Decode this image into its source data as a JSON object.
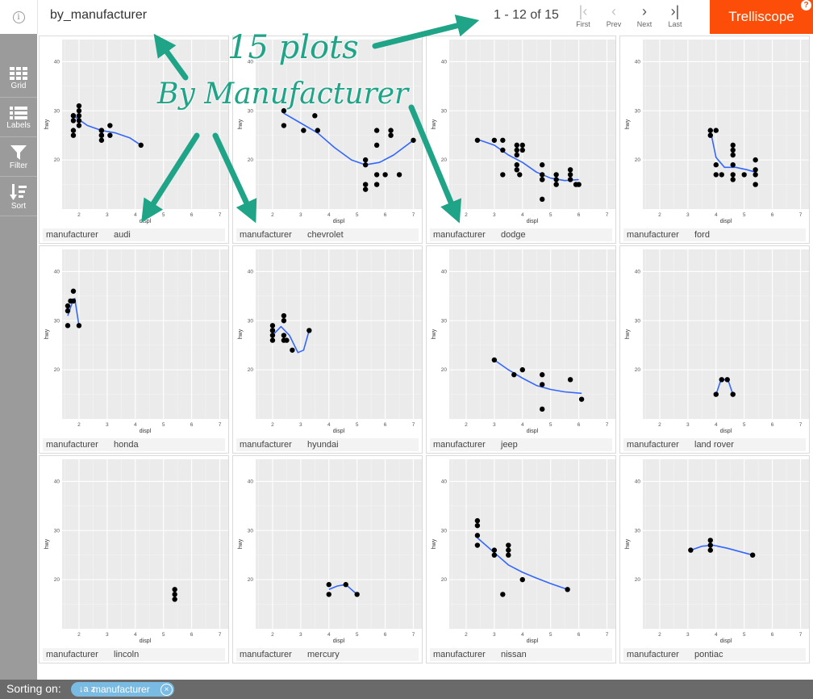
{
  "header": {
    "display_name": "by_manufacturer",
    "pager_text": "1 - 12 of 15",
    "nav": {
      "first": "First",
      "prev": "Prev",
      "next": "Next",
      "last": "Last"
    },
    "brand": "Trelliscope",
    "help": "?"
  },
  "sidebar": {
    "items": [
      {
        "label": "Grid",
        "icon": "grid-icon"
      },
      {
        "label": "Labels",
        "icon": "list-icon"
      },
      {
        "label": "Filter",
        "icon": "funnel-icon"
      },
      {
        "label": "Sort",
        "icon": "sort-icon"
      }
    ]
  },
  "strip_key": "manufacturer",
  "axes": {
    "xlabel": "displ",
    "ylabel": "hwy",
    "xticks": [
      "2",
      "3",
      "4",
      "5",
      "6",
      "7"
    ],
    "yticks": [
      "20",
      "30",
      "40"
    ],
    "xlim": [
      1.4,
      7.3
    ],
    "ylim": [
      10,
      44.5
    ]
  },
  "panels": [
    {
      "manufacturer": "audi",
      "points": [
        [
          1.8,
          29
        ],
        [
          1.8,
          29
        ],
        [
          2,
          31
        ],
        [
          2,
          30
        ],
        [
          2.8,
          26
        ],
        [
          2.8,
          26
        ],
        [
          3.1,
          27
        ],
        [
          1.8,
          26
        ],
        [
          1.8,
          25
        ],
        [
          2,
          28
        ],
        [
          2,
          27
        ],
        [
          2.8,
          25
        ],
        [
          2.8,
          25
        ],
        [
          3.1,
          25
        ],
        [
          4.2,
          23
        ],
        [
          1.8,
          28
        ],
        [
          2,
          29
        ],
        [
          2.8,
          24
        ]
      ],
      "smooth": [
        [
          1.8,
          29
        ],
        [
          2.3,
          27
        ],
        [
          2.8,
          26
        ],
        [
          3.3,
          25.5
        ],
        [
          3.8,
          24.5
        ],
        [
          4.2,
          23
        ]
      ]
    },
    {
      "manufacturer": "chevrolet",
      "points": [
        [
          2.4,
          30
        ],
        [
          2.4,
          27
        ],
        [
          3.1,
          26
        ],
        [
          3.5,
          29
        ],
        [
          3.6,
          26
        ],
        [
          5.3,
          20
        ],
        [
          5.3,
          19
        ],
        [
          5.3,
          15
        ],
        [
          5.3,
          14
        ],
        [
          5.7,
          17
        ],
        [
          6,
          17
        ],
        [
          5.7,
          26
        ],
        [
          5.7,
          23
        ],
        [
          6.2,
          26
        ],
        [
          6.2,
          25
        ],
        [
          7,
          24
        ],
        [
          5.7,
          15
        ],
        [
          6.5,
          17
        ]
      ],
      "smooth": [
        [
          2.4,
          29.5
        ],
        [
          3,
          27.5
        ],
        [
          3.6,
          25.5
        ],
        [
          4.2,
          22.5
        ],
        [
          4.8,
          20
        ],
        [
          5.3,
          19
        ],
        [
          5.8,
          19.5
        ],
        [
          6.3,
          21
        ],
        [
          7,
          24
        ]
      ]
    },
    {
      "manufacturer": "dodge",
      "points": [
        [
          2.4,
          24
        ],
        [
          3,
          24
        ],
        [
          3.3,
          22
        ],
        [
          3.3,
          24
        ],
        [
          3.3,
          17
        ],
        [
          3.8,
          22
        ],
        [
          3.8,
          21
        ],
        [
          3.8,
          18
        ],
        [
          3.8,
          19
        ],
        [
          4,
          23
        ],
        [
          3.9,
          17
        ],
        [
          4.7,
          17
        ],
        [
          4.7,
          16
        ],
        [
          4.7,
          12
        ],
        [
          4.7,
          19
        ],
        [
          5.2,
          17
        ],
        [
          5.2,
          15
        ],
        [
          5.7,
          16
        ],
        [
          5.9,
          15
        ],
        [
          4.7,
          16
        ],
        [
          5.2,
          16
        ],
        [
          5.7,
          18
        ],
        [
          5.7,
          17
        ],
        [
          6,
          15
        ],
        [
          3.8,
          23
        ],
        [
          4,
          22
        ]
      ],
      "smooth": [
        [
          2.4,
          24.2
        ],
        [
          3,
          23
        ],
        [
          3.5,
          21
        ],
        [
          4,
          19.5
        ],
        [
          4.5,
          17.5
        ],
        [
          5,
          16.3
        ],
        [
          5.5,
          15.8
        ],
        [
          6,
          16
        ]
      ]
    },
    {
      "manufacturer": "ford",
      "points": [
        [
          3.8,
          25
        ],
        [
          3.8,
          26
        ],
        [
          4,
          26
        ],
        [
          4,
          19
        ],
        [
          4,
          17
        ],
        [
          4.2,
          17
        ],
        [
          4.6,
          23
        ],
        [
          4.6,
          22
        ],
        [
          4.6,
          21
        ],
        [
          4.6,
          19
        ],
        [
          4.6,
          17
        ],
        [
          4.6,
          16
        ],
        [
          5,
          17
        ],
        [
          5.4,
          20
        ],
        [
          5.4,
          18
        ],
        [
          5.4,
          17
        ],
        [
          5.4,
          15
        ]
      ],
      "smooth": [
        [
          3.8,
          26
        ],
        [
          4,
          20.5
        ],
        [
          4.3,
          18.5
        ],
        [
          4.7,
          18.5
        ],
        [
          5.1,
          18
        ],
        [
          5.4,
          17.5
        ]
      ]
    },
    {
      "manufacturer": "honda",
      "points": [
        [
          1.6,
          33
        ],
        [
          1.6,
          32
        ],
        [
          1.6,
          29
        ],
        [
          1.8,
          36
        ],
        [
          1.8,
          34
        ],
        [
          2,
          29
        ],
        [
          1.7,
          34
        ]
      ],
      "smooth": [
        [
          1.6,
          31
        ],
        [
          1.75,
          33.5
        ],
        [
          1.85,
          34.5
        ],
        [
          2,
          29
        ]
      ]
    },
    {
      "manufacturer": "hyundai",
      "points": [
        [
          2,
          26
        ],
        [
          2,
          27
        ],
        [
          2,
          29
        ],
        [
          2,
          28
        ],
        [
          2.4,
          31
        ],
        [
          2.4,
          30
        ],
        [
          2.4,
          27
        ],
        [
          2.4,
          26
        ],
        [
          2.5,
          26
        ],
        [
          2.7,
          24
        ],
        [
          3.3,
          28
        ],
        [
          2,
          28
        ]
      ],
      "smooth": [
        [
          2,
          27
        ],
        [
          2.3,
          28.8
        ],
        [
          2.6,
          27
        ],
        [
          2.9,
          23.5
        ],
        [
          3.1,
          24
        ],
        [
          3.3,
          28
        ]
      ]
    },
    {
      "manufacturer": "jeep",
      "points": [
        [
          3,
          22
        ],
        [
          3.7,
          19
        ],
        [
          4,
          20
        ],
        [
          4.7,
          19
        ],
        [
          4.7,
          17
        ],
        [
          4.7,
          12
        ],
        [
          5.7,
          18
        ],
        [
          6.1,
          14
        ]
      ],
      "smooth": [
        [
          3,
          22
        ],
        [
          3.5,
          20
        ],
        [
          4,
          18.3
        ],
        [
          4.5,
          16.8
        ],
        [
          5,
          16
        ],
        [
          5.5,
          15.5
        ],
        [
          6.1,
          15.2
        ]
      ]
    },
    {
      "manufacturer": "land rover",
      "points": [
        [
          4,
          15
        ],
        [
          4.2,
          18
        ],
        [
          4.4,
          18
        ],
        [
          4.6,
          15
        ]
      ],
      "smooth": [
        [
          4,
          15
        ],
        [
          4.15,
          17.5
        ],
        [
          4.3,
          18
        ],
        [
          4.45,
          17.5
        ],
        [
          4.6,
          15
        ]
      ]
    },
    {
      "manufacturer": "lincoln",
      "points": [
        [
          5.4,
          18
        ],
        [
          5.4,
          17
        ],
        [
          5.4,
          16
        ]
      ],
      "smooth": []
    },
    {
      "manufacturer": "mercury",
      "points": [
        [
          4,
          19
        ],
        [
          4,
          17
        ],
        [
          4.6,
          19
        ],
        [
          5,
          17
        ]
      ],
      "smooth": [
        [
          4,
          18
        ],
        [
          4.3,
          18.7
        ],
        [
          4.6,
          19
        ],
        [
          4.8,
          18
        ],
        [
          5,
          17
        ]
      ]
    },
    {
      "manufacturer": "nissan",
      "points": [
        [
          2.4,
          32
        ],
        [
          2.4,
          31
        ],
        [
          2.4,
          29
        ],
        [
          2.4,
          27
        ],
        [
          3,
          26
        ],
        [
          3,
          25
        ],
        [
          3.3,
          17
        ],
        [
          3.5,
          27
        ],
        [
          3.5,
          26
        ],
        [
          3.5,
          25
        ],
        [
          4,
          20
        ],
        [
          5.6,
          18
        ]
      ],
      "smooth": [
        [
          2.4,
          28.5
        ],
        [
          3,
          25.5
        ],
        [
          3.5,
          23
        ],
        [
          4,
          21.5
        ],
        [
          4.5,
          20.3
        ],
        [
          5,
          19.2
        ],
        [
          5.6,
          18
        ]
      ]
    },
    {
      "manufacturer": "pontiac",
      "points": [
        [
          3.1,
          26
        ],
        [
          3.8,
          27
        ],
        [
          3.8,
          26
        ],
        [
          3.8,
          28
        ],
        [
          5.3,
          25
        ]
      ],
      "smooth": [
        [
          3.1,
          26
        ],
        [
          3.5,
          26.8
        ],
        [
          3.9,
          27
        ],
        [
          4.4,
          26.4
        ],
        [
          5.3,
          25
        ]
      ]
    }
  ],
  "footer": {
    "label": "Sorting on:",
    "sort_field": "manufacturer",
    "sort_glyph": "↓a z"
  },
  "annotations": {
    "count_text": "15 plots",
    "by_text": "By Manufacturer"
  },
  "colors": {
    "brand": "#fc4e08",
    "smooth": "#3366ff",
    "annotation": "#1fa488",
    "chip": "#79bbe3"
  }
}
